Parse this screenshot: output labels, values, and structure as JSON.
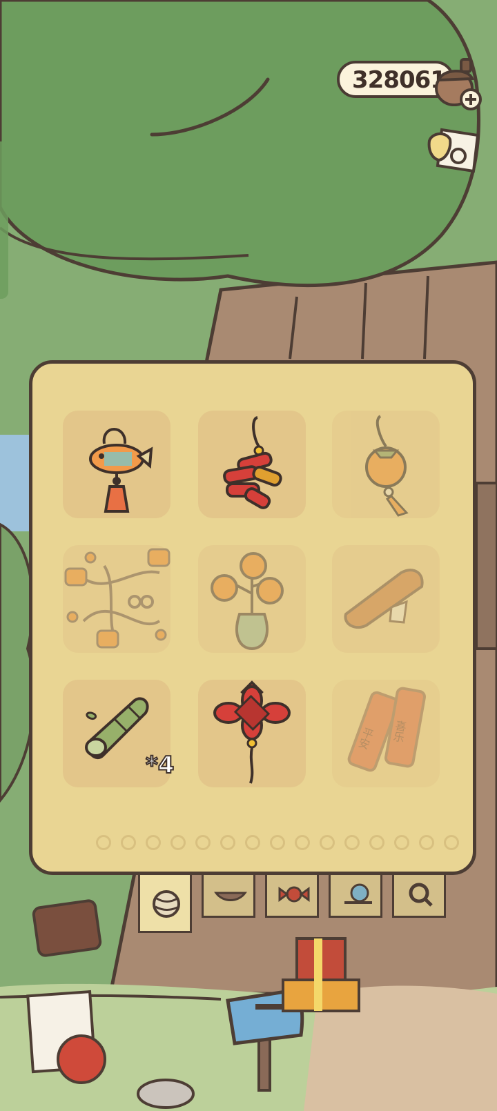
{
  "hud": {
    "clover_count": "328061",
    "add_clover_icon": "plus-icon",
    "acorn_icon": "acorn-icon",
    "ticket_icon": "ticket-icon"
  },
  "inventory": {
    "items": [
      {
        "name": "fish-lantern-charm",
        "icon": "fish-charm-icon",
        "owned": true
      },
      {
        "name": "firecracker-string",
        "icon": "firecracker-icon",
        "owned": true
      },
      {
        "name": "persimmon-charm",
        "icon": "persimmon-charm-icon",
        "owned": false
      },
      {
        "name": "lantern-garland",
        "icon": "garland-icon",
        "owned": false
      },
      {
        "name": "persimmon-tree-vase",
        "icon": "persimmon-tree-icon",
        "owned": false
      },
      {
        "name": "spring-roll",
        "icon": "spring-roll-icon",
        "owned": false
      },
      {
        "name": "bamboo-tube",
        "icon": "bamboo-icon",
        "owned": true,
        "quantity": "*4"
      },
      {
        "name": "chinese-knot",
        "icon": "chinese-knot-icon",
        "owned": true
      },
      {
        "name": "spring-couplets",
        "icon": "couplets-icon",
        "owned": false
      }
    ],
    "page_count": 15,
    "couplet_text": [
      "平安",
      "喜乐"
    ]
  },
  "tabs": [
    {
      "name": "yarn",
      "icon": "yarn-ball-icon",
      "active": true
    },
    {
      "name": "food",
      "icon": "dish-icon",
      "active": false
    },
    {
      "name": "candy",
      "icon": "candy-icon",
      "active": false
    },
    {
      "name": "snail",
      "icon": "snail-icon",
      "active": false
    },
    {
      "name": "search",
      "icon": "magnifier-icon",
      "active": false
    }
  ],
  "colors": {
    "panel": "#e9d593",
    "slot": "#e3c68a",
    "outline": "#4d3d34",
    "tree_canopy": "#6d9d5e",
    "trunk": "#a98a72"
  }
}
